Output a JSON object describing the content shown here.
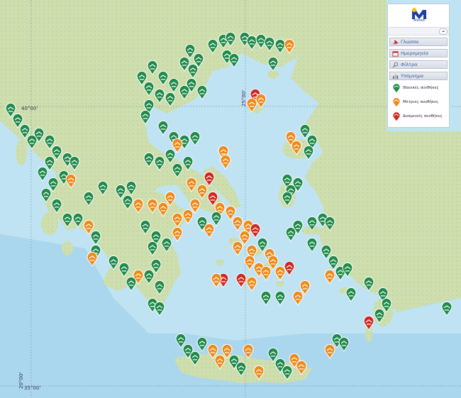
{
  "map": {
    "coordinate_labels": [
      "40°00'",
      "35°00'",
      "25°00'",
      "20°00'"
    ]
  },
  "colors": {
    "ideal": "#1f8a4a",
    "moderate": "#ef8a1a",
    "adverse": "#d0261f",
    "sea": "#bfe3f3",
    "land": "#cfe0b0",
    "menu_text": "#3b5a96"
  },
  "panel": {
    "logo_name": "Meteo",
    "search": {
      "value": "",
      "button_icon": "cloud-icon"
    },
    "menu": [
      {
        "label": "Γλώσσα",
        "icon": "pin-icon"
      },
      {
        "label": "Ημερομηνία",
        "icon": "calendar-icon"
      },
      {
        "label": "Φίλτρα",
        "icon": "magnifier-icon"
      },
      {
        "label": "Υπόμνημα",
        "icon": "chart-icon"
      }
    ],
    "legend": [
      {
        "label": "Ιδανικές συνθήκες",
        "status": "ideal"
      },
      {
        "label": "Μέτριες συνθήκες",
        "status": "moderate"
      },
      {
        "label": "Δυσμενείς συνθήκες",
        "status": "adverse"
      }
    ]
  }
}
